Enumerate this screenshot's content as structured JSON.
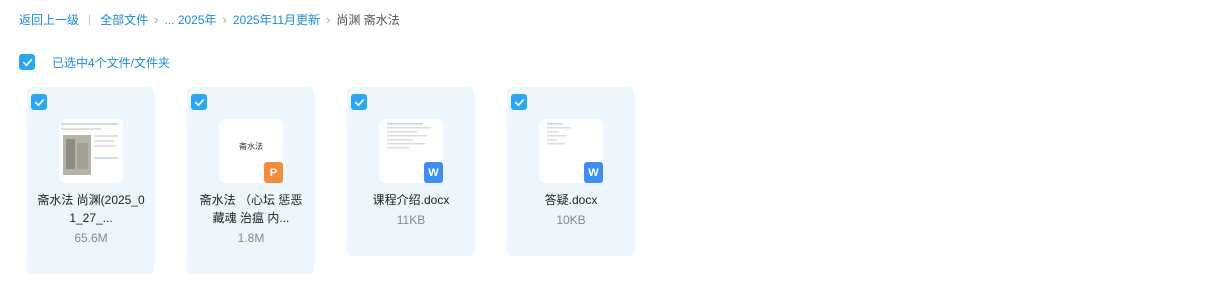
{
  "breadcrumb": {
    "back": "返回上一级",
    "items": [
      "全部文件",
      "... 2025年",
      "2025年11月更新"
    ],
    "current": "尚渊 斋水法"
  },
  "selection": {
    "label": "已选中4个文件/文件夹"
  },
  "files": [
    {
      "name": "斋水法 尚渊(2025_01_27_...",
      "size": "65.6M",
      "type": "image-doc"
    },
    {
      "name": "斋水法 （心坛 惩恶藏魂 治瘟 内...",
      "size": "1.8M",
      "type": "ppt",
      "thumb_text": "斋水法"
    },
    {
      "name": "课程介绍.docx",
      "size": "11KB",
      "type": "word"
    },
    {
      "name": "答疑.docx",
      "size": "10KB",
      "type": "word"
    }
  ],
  "icons": {
    "check": "check-icon",
    "ppt": "ppt-file-icon",
    "word": "word-file-icon",
    "separator": "chevron-right-icon"
  },
  "colors": {
    "accent": "#2aa7f3",
    "link": "#1a8cd8",
    "card_bg": "#eef6fd",
    "ppt": "#f58b3c",
    "word": "#3f8cf4"
  }
}
